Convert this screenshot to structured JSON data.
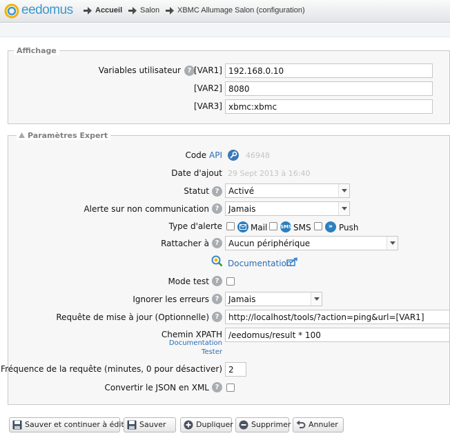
{
  "header": {
    "logo_text": "eedomus",
    "breadcrumb": [
      "Accueil",
      "Salon",
      "XBMC Allumage Salon (configuration)"
    ]
  },
  "affichage": {
    "legend": "Affichage",
    "vars_label": "Variables utilisateur",
    "var1_tag": "[VAR1]",
    "var1_value": "192.168.0.10",
    "var2_tag": "[VAR2]",
    "var2_value": "8080",
    "var3_tag": "[VAR3]",
    "var3_value": "xbmc:xbmc"
  },
  "expert": {
    "legend": "Paramètres Expert",
    "code_label": "Code",
    "code_api_link": "API",
    "code_value": "46948",
    "date_label": "Date d'ajout",
    "date_value": "29 Sept 2013 à 16:40",
    "statut_label": "Statut",
    "statut_value": "Activé",
    "alerte_label": "Alerte sur non communication",
    "alerte_value": "Jamais",
    "type_alerte_label": "Type d'alerte",
    "type_alerte_options": [
      "Mail",
      "SMS",
      "Push"
    ],
    "rattacher_label": "Rattacher à",
    "rattacher_value": "Aucun périphérique",
    "documentation_link": "Documentation",
    "mode_test_label": "Mode test",
    "ignorer_label": "Ignorer les erreurs",
    "ignorer_value": "Jamais",
    "requete_label": "Requête de mise à jour (Optionnelle)",
    "requete_value": "http://localhost/tools/?action=ping&url=[VAR1]",
    "xpath_label": "Chemin XPATH",
    "xpath_doc_link": "Documentation",
    "xpath_tester_link": "Tester",
    "xpath_value": "/eedomus/result * 100",
    "frequence_label": "Fréquence de la requête (minutes, 0 pour désactiver)",
    "frequence_value": "2",
    "json_label": "Convertir le JSON en XML"
  },
  "buttons": {
    "save_continue": "Sauver et continuer à éditer",
    "save": "Sauver",
    "duplicate": "Dupliquer",
    "delete": "Supprimer",
    "cancel": "Annuler"
  },
  "colors": {
    "accent": "#2a6cb5",
    "logo": "#3d98cf"
  }
}
